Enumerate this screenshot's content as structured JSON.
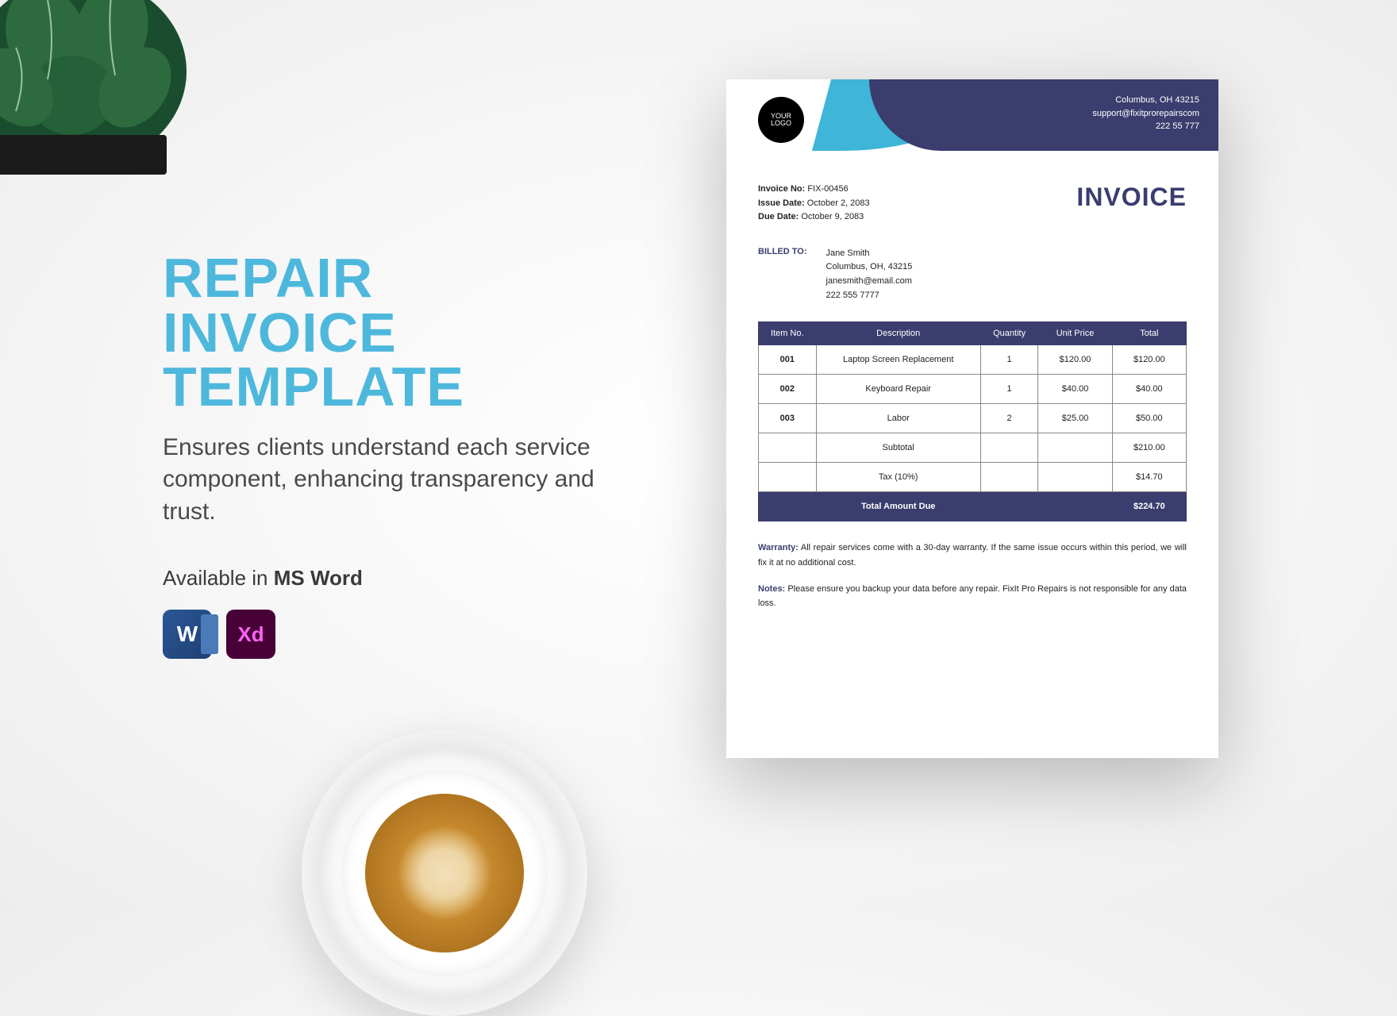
{
  "promo": {
    "title_line1": "REPAIR",
    "title_line2": "INVOICE",
    "title_line3": "TEMPLATE",
    "subtitle": "Ensures clients understand each service component, enhancing transparency and trust.",
    "availability_prefix": "Available in ",
    "availability_app": "MS Word"
  },
  "invoice": {
    "logo_line1": "YOUR",
    "logo_line2": "LOGO",
    "contact": {
      "location": "Columbus, OH 43215",
      "email": "support@fixitprorepairscom",
      "phone": "222 55 777"
    },
    "meta": {
      "invoice_no_label": "Invoice No:",
      "invoice_no": "FIX-00456",
      "issue_date_label": "Issue Date:",
      "issue_date": "October 2, 2083",
      "due_date_label": "Due Date:",
      "due_date": "October 9, 2083"
    },
    "title": "INVOICE",
    "billed_to_label": "BILLED TO:",
    "billed_to": {
      "name": "Jane Smith",
      "address": "Columbus, OH, 43215",
      "email": "janesmith@email.com",
      "phone": "222 555 7777"
    },
    "columns": {
      "item": "Item No.",
      "desc": "Description",
      "qty": "Quantity",
      "price": "Unit Price",
      "total": "Total"
    },
    "items": [
      {
        "no": "001",
        "desc": "Laptop Screen Replacement",
        "qty": "1",
        "price": "$120.00",
        "total": "$120.00"
      },
      {
        "no": "002",
        "desc": "Keyboard Repair",
        "qty": "1",
        "price": "$40.00",
        "total": "$40.00"
      },
      {
        "no": "003",
        "desc": "Labor",
        "qty": "2",
        "price": "$25.00",
        "total": "$50.00"
      }
    ],
    "subtotal_label": "Subtotal",
    "subtotal": "$210.00",
    "tax_label": "Tax (10%)",
    "tax": "$14.70",
    "total_due_label": "Total Amount Due",
    "total_due": "$224.70",
    "warranty_label": "Warranty:",
    "warranty_text": " All repair services come with a 30-day warranty. If the same issue occurs within this period, we will fix it at no additional cost.",
    "notes_label": "Notes:",
    "notes_text": " Please ensure you backup your data before any repair. FixIt Pro Repairs is not responsible for any data loss."
  }
}
